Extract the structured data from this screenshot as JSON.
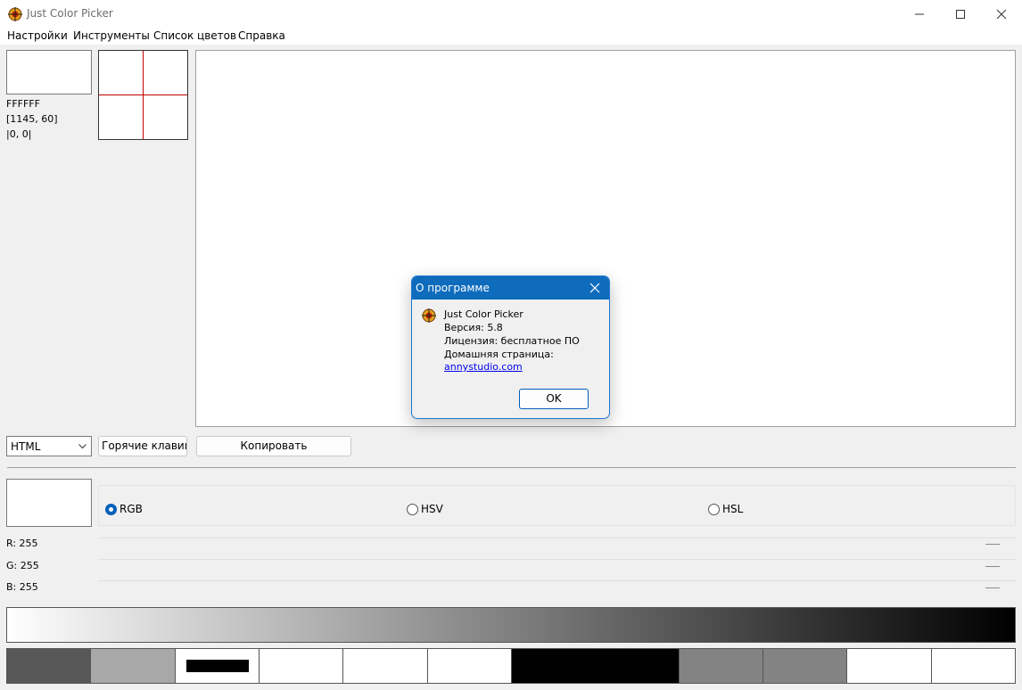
{
  "window": {
    "title": "Just Color Picker",
    "icon": "crosshair-target-icon"
  },
  "menu": {
    "items": [
      "Настройки",
      "Инструменты",
      "Список цветов",
      "Справка"
    ]
  },
  "picker": {
    "current_color_hex": "#FFFFFF",
    "hex_text": "FFFFFF",
    "position_text": "[1145, 60]",
    "offset_text": "|0, 0|"
  },
  "controls": {
    "format_select_value": "HTML",
    "hotkeys_button_label": "Горячие клавиши",
    "copy_button_label": "Копировать"
  },
  "color_modes": {
    "options": [
      "RGB",
      "HSV",
      "HSL"
    ],
    "selected": "RGB"
  },
  "channels": [
    {
      "label": "R: 255"
    },
    {
      "label": "G: 255"
    },
    {
      "label": "B: 255"
    }
  ],
  "gradient": {
    "from": "#FFFFFF",
    "to": "#000000"
  },
  "swatches": [
    "#575757",
    "#a8a8a8",
    "#000000-on-#ffffff",
    "#ffffff",
    "#ffffff",
    "#ffffff",
    "#000000",
    "#000000",
    "#838383",
    "#838383",
    "#ffffff",
    "#ffffff"
  ],
  "about_dialog": {
    "title": "О программе",
    "app_name": "Just Color Picker",
    "version": "Версия: 5.8",
    "license": "Лицензия: бесплатное ПО",
    "homepage_label": "Домашняя страница:",
    "homepage_link": "annystudio.com",
    "ok_label": "OK"
  },
  "colors": {
    "accent": "#0F6CBD",
    "crosshair": "#C00000",
    "link": "#0000EE"
  }
}
